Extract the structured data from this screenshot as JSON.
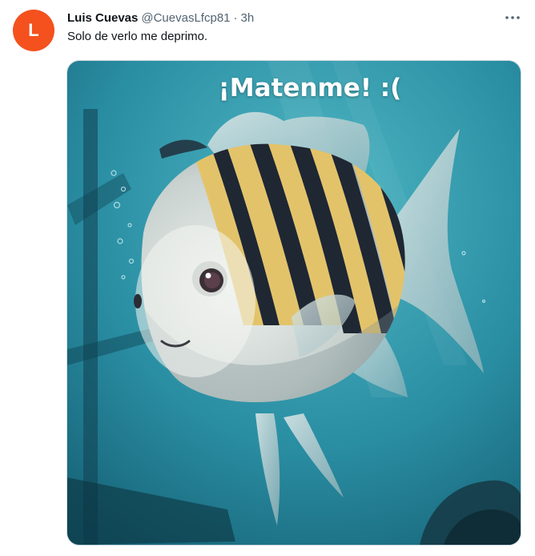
{
  "author": {
    "avatar_letter": "L",
    "avatar_color": "#f4511e",
    "display_name": "Luis Cuevas",
    "handle": "@CuevasLfcp81",
    "separator": "·",
    "time": "3h"
  },
  "tweet": {
    "text": "Solo de verlo me deprimo."
  },
  "menu": {
    "icon": "more-horizontal-icon"
  },
  "media": {
    "caption": "¡Matenme! :(",
    "description_colors": {
      "water": "#2b8fa3",
      "fish_stripe_yellow": "#e3c36a",
      "fish_stripe_dark": "#1f2733"
    }
  }
}
